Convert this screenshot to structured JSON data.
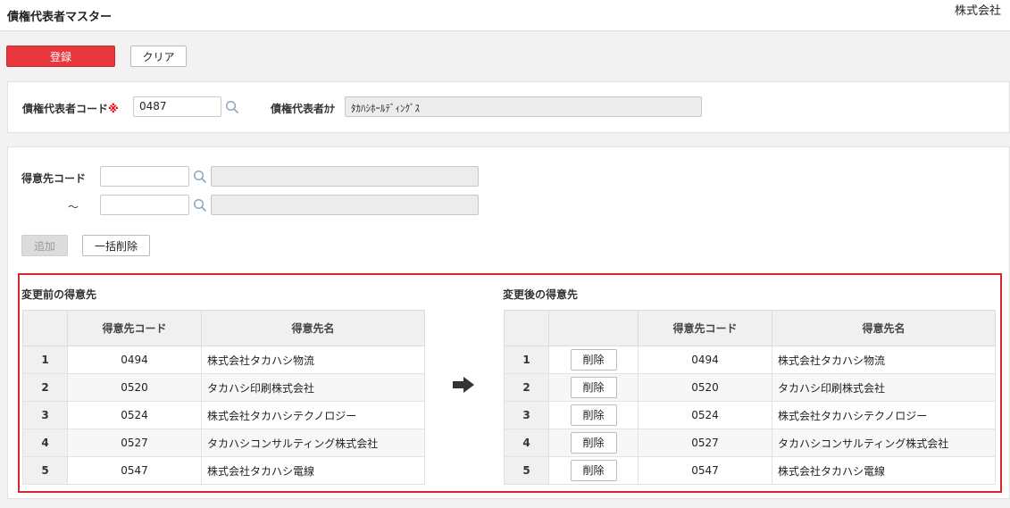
{
  "header": {
    "title": "債権代表者マスター",
    "company": "株式会社"
  },
  "toolbar": {
    "register_label": "登録",
    "clear_label": "クリア"
  },
  "rep": {
    "code_label": "債権代表者コード",
    "required_mark": "※",
    "code_value": "0487",
    "kana_label": "債権代表者ｶﾅ",
    "kana_value": "ﾀｶﾊｼﾎｰﾙﾃﾞｨﾝｸﾞｽ"
  },
  "range": {
    "label": "得意先コード",
    "tilde": "～",
    "from_value": "",
    "to_value": "",
    "from_name": "",
    "to_name": "",
    "add_label": "追加",
    "bulk_delete_label": "一括削除"
  },
  "before": {
    "title": "変更前の得意先",
    "headers": [
      "",
      "得意先コード",
      "得意先名"
    ],
    "rows": [
      {
        "no": "1",
        "code": "0494",
        "name": "株式会社タカハシ物流"
      },
      {
        "no": "2",
        "code": "0520",
        "name": "タカハシ印刷株式会社"
      },
      {
        "no": "3",
        "code": "0524",
        "name": "株式会社タカハシテクノロジー"
      },
      {
        "no": "4",
        "code": "0527",
        "name": "タカハシコンサルティング株式会社"
      },
      {
        "no": "5",
        "code": "0547",
        "name": "株式会社タカハシ電線"
      }
    ]
  },
  "after": {
    "title": "変更後の得意先",
    "headers": [
      "",
      "",
      "得意先コード",
      "得意先名"
    ],
    "delete_label": "削除",
    "rows": [
      {
        "no": "1",
        "code": "0494",
        "name": "株式会社タカハシ物流"
      },
      {
        "no": "2",
        "code": "0520",
        "name": "タカハシ印刷株式会社"
      },
      {
        "no": "3",
        "code": "0524",
        "name": "株式会社タカハシテクノロジー"
      },
      {
        "no": "4",
        "code": "0527",
        "name": "タカハシコンサルティング株式会社"
      },
      {
        "no": "5",
        "code": "0547",
        "name": "株式会社タカハシ電線"
      }
    ]
  },
  "icons": {
    "search": "search-icon",
    "arrow": "arrow-right-icon"
  },
  "colors": {
    "primary": "#e8383d",
    "highlight_border": "#d9262e",
    "required": "#e60012"
  }
}
